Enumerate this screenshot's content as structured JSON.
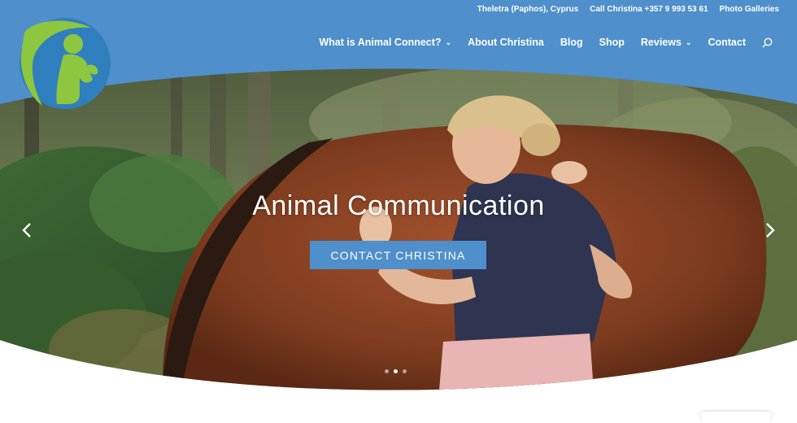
{
  "topbar": {
    "location": "Theletra (Paphos), Cyprus",
    "phone": "Call Christina +357 9 993 53 61",
    "galleries": "Photo Galleries"
  },
  "nav": {
    "items": [
      {
        "label": "What is Animal Connect?",
        "dropdown": true
      },
      {
        "label": "About Christina",
        "dropdown": false
      },
      {
        "label": "Blog",
        "dropdown": false
      },
      {
        "label": "Shop",
        "dropdown": false
      },
      {
        "label": "Reviews",
        "dropdown": true
      },
      {
        "label": "Contact",
        "dropdown": false
      }
    ],
    "search_icon": "search-icon"
  },
  "hero": {
    "headline": "Animal Communication",
    "cta_label": "CONTACT CHRISTINA",
    "slides_total": 3,
    "active_slide": 2,
    "prev_icon": "chevron-left-icon",
    "next_icon": "chevron-right-icon"
  },
  "colors": {
    "header_blue": "#4f8fcb",
    "logo_green": "#8dc63f",
    "logo_blue": "#2f7fbf",
    "text": "#ffffff"
  }
}
